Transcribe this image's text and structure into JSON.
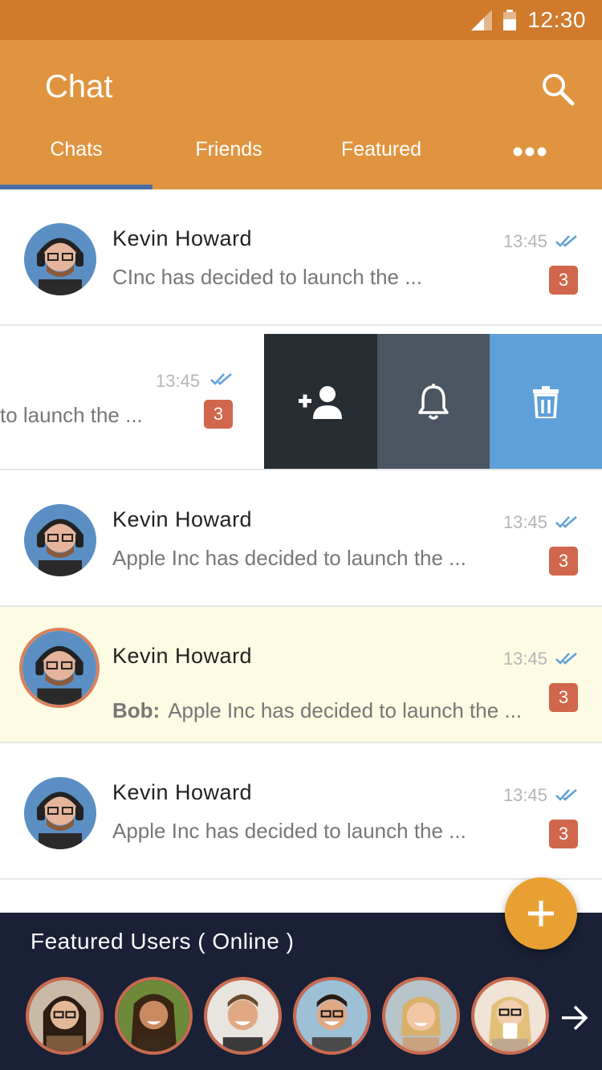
{
  "status_bar": {
    "time": "12:30"
  },
  "app_bar": {
    "title": "Chat",
    "tabs": [
      {
        "label": "Chats"
      },
      {
        "label": "Friends"
      },
      {
        "label": "Featured"
      }
    ],
    "active_tab": "Chats"
  },
  "conversations": [
    {
      "name": "Kevin Howard",
      "preview": "CInc has decided to launch the ...",
      "time": "13:45",
      "badge": "3"
    },
    {
      "name": "",
      "preview": "to launch the ...",
      "time": "13:45",
      "badge": "3",
      "swiped": true
    },
    {
      "name": "Kevin Howard",
      "preview": "Apple Inc has decided to launch the ...",
      "time": "13:45",
      "badge": "3"
    },
    {
      "name": "Kevin Howard",
      "sender": "Bob:",
      "preview": "Apple Inc has decided to launch the ...",
      "time": "13:45",
      "badge": "3",
      "highlighted": true
    },
    {
      "name": "Kevin Howard",
      "preview": "Apple Inc has decided to launch the ...",
      "time": "13:45",
      "badge": "3"
    }
  ],
  "swipe_actions": [
    "add-friend-icon",
    "bell-icon",
    "trash-icon"
  ],
  "featured": {
    "title": "Featured Users ( Online )"
  },
  "colors": {
    "status_bar": "#d07a2c",
    "app_bar": "#e0943f",
    "tab_indicator": "#4a6fa5",
    "badge": "#d0674c",
    "highlight_row": "#fdfbe4",
    "action_add": "#262d33",
    "action_bell": "#4a5661",
    "action_trash": "#5fa0d8",
    "featured_bg": "#1a2035",
    "fab": "#e8a032"
  }
}
